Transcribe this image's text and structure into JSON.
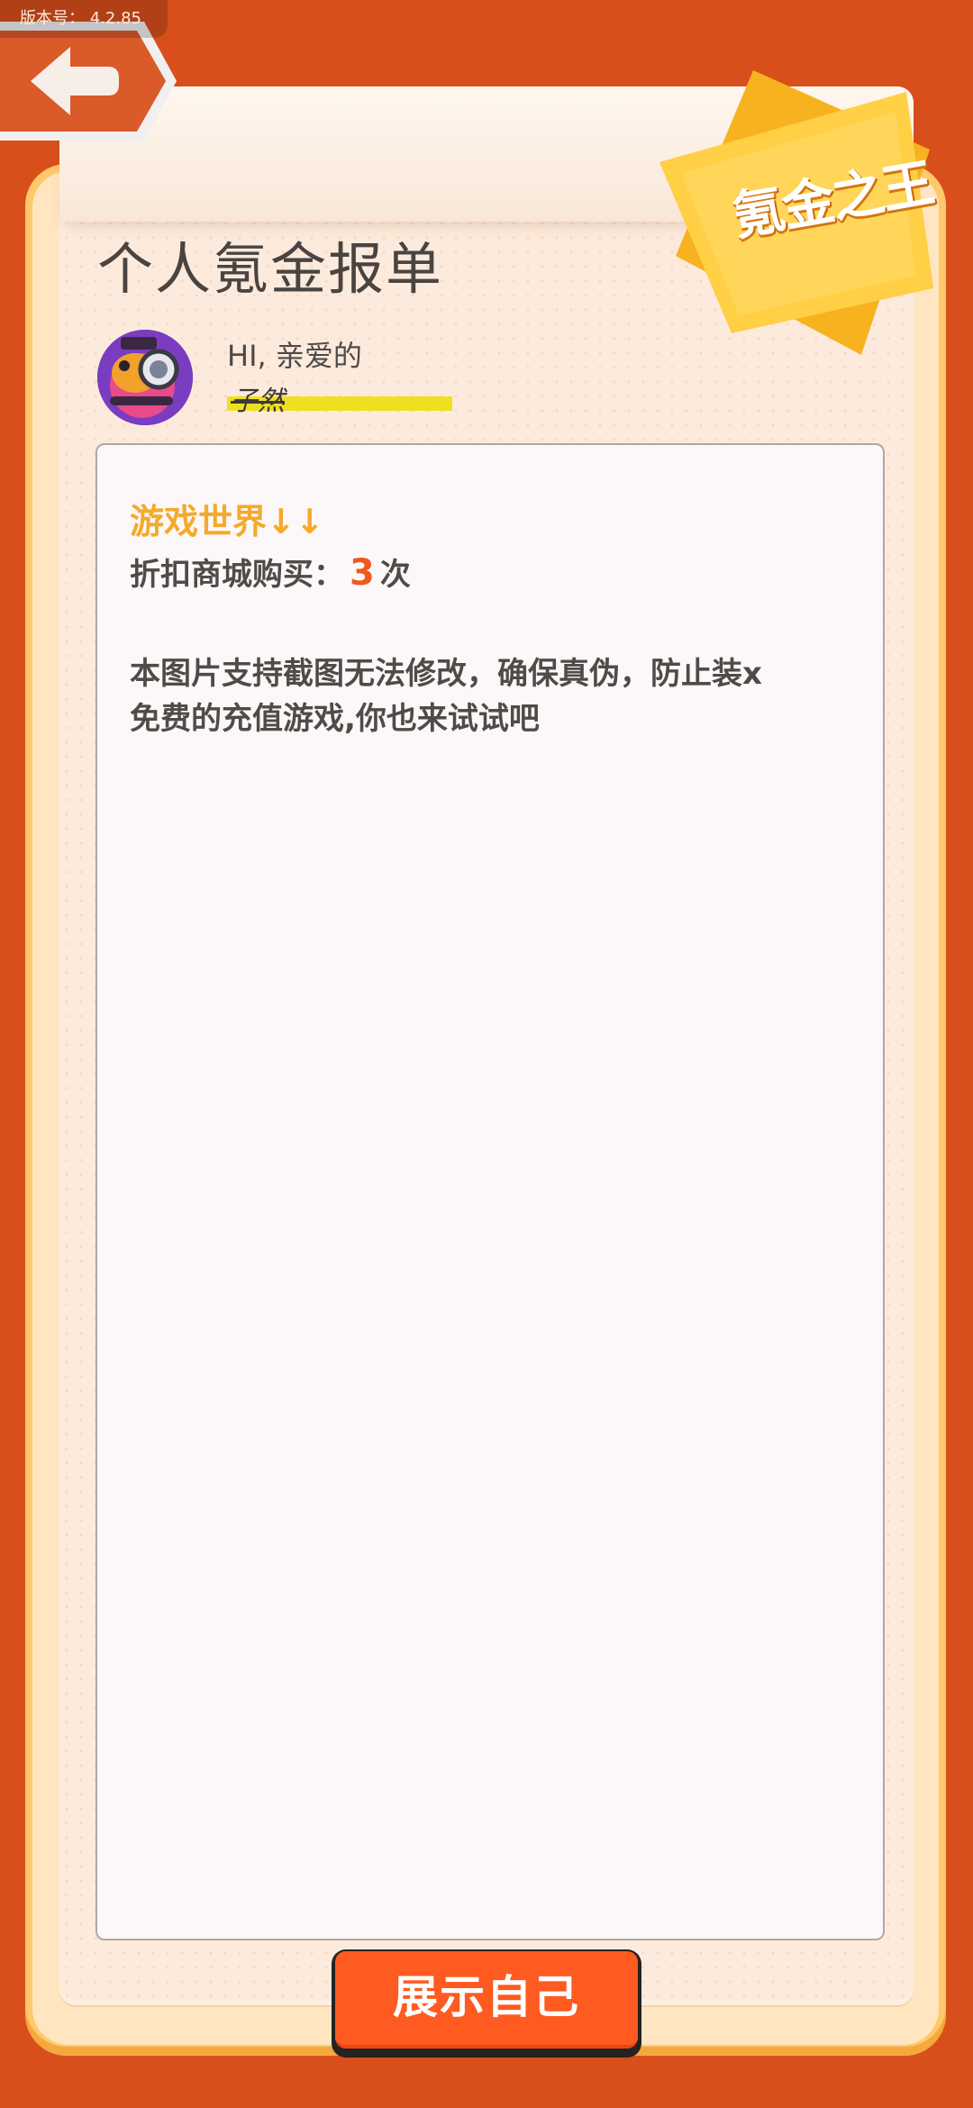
{
  "app": {
    "version_text": "版本号： 4.2.85"
  },
  "header": {
    "back_icon": "arrow-left-icon",
    "title": "个人氪金报单",
    "badge_text": "氪金之王"
  },
  "user": {
    "greeting": "HI, 亲爱的",
    "name": "子然"
  },
  "report": {
    "section_title": "游戏世界↓↓",
    "purchase_label": "折扣商城购买：",
    "purchase_count": "3",
    "purchase_unit": "次",
    "description_lines": [
      "本图片支持截图无法修改，确保真伪，防止装x",
      "免费的充值游戏,你也来试试吧"
    ]
  },
  "footer": {
    "show_button_label": "展示自己"
  },
  "colors": {
    "frame": "#D84F1C",
    "accent_orange": "#FF5A20",
    "title_yellow": "#F4AA2A",
    "count_orange": "#F0581D",
    "highlight_yellow": "#EFE01F"
  }
}
